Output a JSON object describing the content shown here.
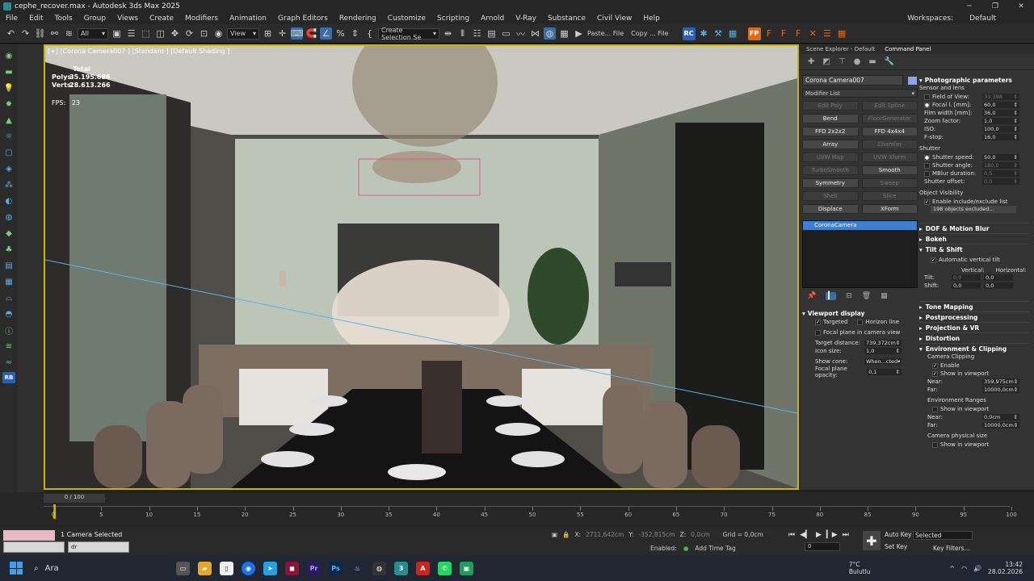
{
  "window": {
    "title": "cephe_recover.max - Autodesk 3ds Max 2025",
    "workspaces_label": "Workspaces:",
    "workspace": "Default"
  },
  "menu": [
    "File",
    "Edit",
    "Tools",
    "Group",
    "Views",
    "Create",
    "Modifiers",
    "Animation",
    "Graph Editors",
    "Rendering",
    "Customize",
    "Scripting",
    "Arnold",
    "V-Ray",
    "Substance",
    "Civil View",
    "Help"
  ],
  "toolbar": {
    "filter": "All",
    "view": "View",
    "selection_set": "Create Selection Se",
    "paste": "Paste... File",
    "copy": "Copy ... File"
  },
  "viewport": {
    "label": "[+] [Corona Camera007 ] [Standard ] [Default Shading ]",
    "total_label": "Total",
    "polys_label": "Polys:",
    "polys": "35.195.686",
    "verts_label": "Verts:",
    "verts": "28.613.266",
    "fps_label": "FPS:",
    "fps": "23"
  },
  "command_panel": {
    "tabs": [
      "Scene Explorer - Default",
      "Command Panel"
    ],
    "object_name": "Corona Camera007",
    "modifier_list": "Modifier List",
    "modifiers": [
      {
        "label": "Edit Poly",
        "enabled": false
      },
      {
        "label": "Edit Spline",
        "enabled": false
      },
      {
        "label": "Bend",
        "enabled": true
      },
      {
        "label": "FloorGenerator",
        "enabled": false
      },
      {
        "label": "FFD 2x2x2",
        "enabled": true
      },
      {
        "label": "FFD 4x4x4",
        "enabled": true
      },
      {
        "label": "Array",
        "enabled": true
      },
      {
        "label": "Chamfer",
        "enabled": false
      },
      {
        "label": "UVW Map",
        "enabled": false
      },
      {
        "label": "UVW Xform",
        "enabled": false
      },
      {
        "label": "TurboSmooth",
        "enabled": false
      },
      {
        "label": "Smooth",
        "enabled": true
      },
      {
        "label": "Symmetry",
        "enabled": true
      },
      {
        "label": "Sweep",
        "enabled": false
      },
      {
        "label": "Shell",
        "enabled": false
      },
      {
        "label": "Slice",
        "enabled": false
      },
      {
        "label": "Displace",
        "enabled": true
      },
      {
        "label": "XForm",
        "enabled": true
      }
    ],
    "stack_item": "CoronaCamera",
    "viewport_display": {
      "title": "Viewport display",
      "targeted": "Targeted",
      "horizon_line": "Horizon line",
      "focal_plane": "Focal plane in camera view",
      "target_distance_label": "Target distance:",
      "target_distance": "739,372cm",
      "icon_size_label": "Icon size:",
      "icon_size": "1,0",
      "show_cone_label": "Show cone:",
      "show_cone": "When...cted",
      "focal_opacity_label": "Focal plane opacity:",
      "focal_opacity": "0,1"
    }
  },
  "params": {
    "photographic": "Photographic parameters",
    "sensor": "Sensor and lens",
    "fov_label": "Field of View:",
    "fov": "33,398",
    "focal_label": "Focal l. [mm]:",
    "focal": "60,0",
    "film_label": "Film width [mm]:",
    "film": "36,0",
    "zoom_label": "Zoom factor:",
    "zoom": "1,0",
    "iso_label": "ISO:",
    "iso": "100,0",
    "fstop_label": "F-stop:",
    "fstop": "16,0",
    "shutter": "Shutter",
    "speed_label": "Shutter speed:",
    "speed": "50,0",
    "angle_label": "Shutter angle:",
    "angle": "180,0",
    "mblur_label": "MBlur duration:",
    "mblur": "0,5",
    "offset_label": "Shutter offset:",
    "offset": "0,0",
    "objvis": "Object Visibility",
    "enable_incl": "Enable include/exclude list",
    "excluded": "198 objects excluded...",
    "dof": "DOF & Motion Blur",
    "bokeh": "Bokeh",
    "tilt": "Tilt & Shift",
    "auto_vertical": "Automatic vertical tilt",
    "vertical": "Vertical:",
    "horizontal": "Horizontal:",
    "tilt_label": "Tilt:",
    "tilt_v": "0,0",
    "tilt_h": "0,0",
    "shift_label": "Shift:",
    "shift_v": "0,0",
    "shift_h": "0,0",
    "tone": "Tone Mapping",
    "post": "Postprocessing",
    "proj": "Projection & VR",
    "distortion": "Distortion",
    "env": "Environment & Clipping",
    "clipping": "Camera Clipping",
    "enable": "Enable",
    "show_vp": "Show in viewport",
    "near_label": "Near:",
    "near": "359,975cm",
    "far_label": "Far:",
    "far": "10000,0cm",
    "env_ranges": "Environment Ranges",
    "env_show": "Show in viewport",
    "env_near": "0,0cm",
    "env_far": "10000,0cm",
    "phys": "Camera physical size",
    "phys_show": "Show in viewport"
  },
  "timeline": {
    "slider": "0 / 100",
    "ticks": [
      "0",
      "5",
      "10",
      "15",
      "20",
      "25",
      "30",
      "35",
      "40",
      "45",
      "50",
      "55",
      "60",
      "65",
      "70",
      "75",
      "80",
      "85",
      "90",
      "95",
      "100"
    ]
  },
  "status": {
    "message": "1 Camera Selected",
    "x_label": "X:",
    "x": "2711,642cm",
    "y_label": "Y:",
    "y": "-352,815cm",
    "z_label": "Z:",
    "z": "0,0cm",
    "grid": "Grid = 0,0cm",
    "enabled": "Enabled:",
    "add_time_tag": "Add Time Tag",
    "auto_key": "Auto Key",
    "set_key": "Set Key",
    "key_mode": "Selected",
    "key_filters": "Key Filters...",
    "frame": "0",
    "tasks": [
      "",
      "dr"
    ]
  },
  "taskbar": {
    "search": "Ara",
    "weather_temp": "7°C",
    "weather": "Bulutlu",
    "time": "13:42",
    "date": "28.02.2026"
  }
}
